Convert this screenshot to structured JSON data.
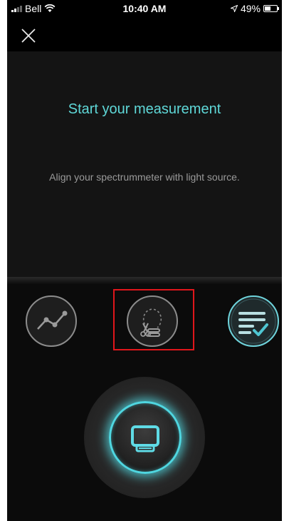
{
  "status_bar": {
    "carrier": "Bell",
    "time": "10:40 AM",
    "battery": "49%",
    "battery_level": 0.49
  },
  "nav": {
    "close_icon": "close-icon"
  },
  "instructions": {
    "title": "Start your measurement",
    "subtitle": "Align your spectrummeter with light source."
  },
  "modes": [
    {
      "icon": "line-chart-icon",
      "state": "inactive"
    },
    {
      "icon": "bulb-cut-icon",
      "state": "inactive"
    },
    {
      "icon": "checklist-icon",
      "state": "active"
    }
  ],
  "capture": {
    "icon": "measure-device-icon"
  },
  "colors": {
    "accent": "#5fd8d8",
    "highlight": "#e0161b",
    "background": "#101010"
  }
}
